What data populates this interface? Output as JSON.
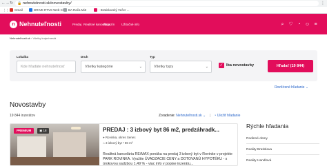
{
  "browser": {
    "url": "nehnutelnosti.sk/novostavby/",
    "bookmarks": [
      {
        "label": "Gmail",
        "color": "#d93025"
      },
      {
        "label": "DRIVE RTVS Web Cl...",
        "color": "#1a73e8"
      },
      {
        "label": "BA Rača MiZ",
        "color": "#9aa0a6"
      },
      {
        "label": "- Bratislavský Večer ...",
        "color": "#e20d5b"
      }
    ]
  },
  "header": {
    "logo_text": "Nehnuteľnosti",
    "nav": [
      "Predaj",
      "Realitné kancelárie",
      "Magazín",
      "Užitočné info"
    ],
    "brand_color": "#e20d5b"
  },
  "breadcrumb": {
    "home": "Nehnuteľnosti.sk",
    "current": "Všetky kraje/mestá"
  },
  "search": {
    "location_label": "Lokalita",
    "location_placeholder": "Kde hľadáte nehnuteľnosť",
    "type_label": "Druh",
    "type_value": "Všetky kategórie",
    "kind_label": "Typ",
    "kind_value": "Všetky typy",
    "new_only_label": "Iba novostavby",
    "search_button": "Hľadať (19 844)"
  },
  "advanced_search_link": "Rozšírené hľadanie",
  "page": {
    "title": "Novostavby",
    "count_text": "19 844 inzerátov",
    "sort_label": "Zoradenie:",
    "sort_value": "Nehnuteľnosti.sk",
    "save_search": "Uložiť hľadanie"
  },
  "listing": {
    "badge": "PREMIUM",
    "photo_count": "18",
    "title": "PREDAJ : 3 izbový byt 86 m2, predzáhradk...",
    "location": "Rovinka, okres Senec",
    "details": "3 izbový byt • 86 m²",
    "description": "Realitná kancelária RE/MAX ponúka na predaj 3 izbový byt v Rovinke v projekte PARK ROVINKA. Využite ÚVADZACIE CENY a DOTOVANÚ HYPOTÉKU - s úrokovou sadzbou 1,49 % - viac info v popise inzerátu..."
  },
  "sidebar": {
    "title": "Rýchle hľadania",
    "items": [
      "Rodinné domy",
      "Reality Bratislava",
      "Reality Handlová"
    ]
  }
}
